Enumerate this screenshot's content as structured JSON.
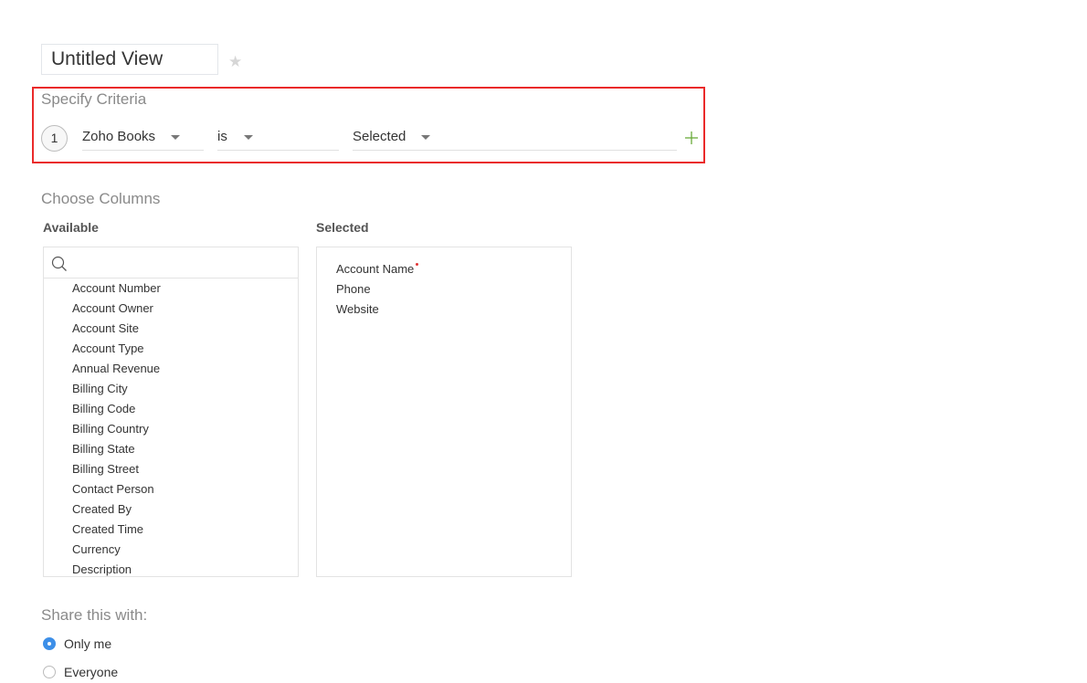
{
  "view": {
    "title": "Untitled View",
    "favorite_icon": "star-icon"
  },
  "criteria": {
    "section_title": "Specify Criteria",
    "highlight_color": "#ea2a2a",
    "rows": [
      {
        "number": "1",
        "field": "Zoho Books",
        "operator": "is",
        "value": "Selected"
      }
    ],
    "add_icon": "plus-icon",
    "add_color": "#6aaa3a"
  },
  "columns": {
    "section_title": "Choose Columns",
    "available": {
      "label": "Available",
      "search_placeholder": "",
      "search_value": "",
      "items": [
        "Account Number",
        "Account Owner",
        "Account Site",
        "Account Type",
        "Annual Revenue",
        "Billing City",
        "Billing Code",
        "Billing Country",
        "Billing State",
        "Billing Street",
        "Contact Person",
        "Created By",
        "Created Time",
        "Currency",
        "Description"
      ]
    },
    "selected": {
      "label": "Selected",
      "items": [
        {
          "label": "Account Name",
          "required": true
        },
        {
          "label": "Phone",
          "required": false
        },
        {
          "label": "Website",
          "required": false
        }
      ]
    }
  },
  "share": {
    "title": "Share this with:",
    "options": [
      {
        "label": "Only me",
        "checked": true
      },
      {
        "label": "Everyone",
        "checked": false
      }
    ],
    "accent_color": "#3d8fe8"
  }
}
